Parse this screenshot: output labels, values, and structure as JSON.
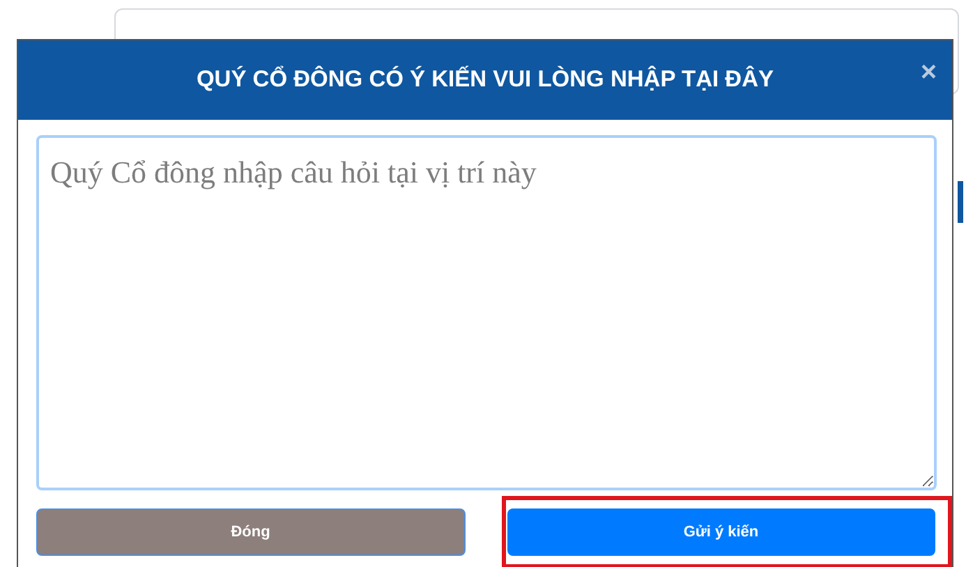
{
  "dialog": {
    "title": "QUÝ CỔ ĐÔNG CÓ Ý KIẾN VUI LÒNG NHẬP TẠI ĐÂY",
    "close": "×",
    "question": {
      "placeholder": "Quý Cổ đông nhập câu hỏi tại vị trí này"
    },
    "buttons": [
      {
        "kind": "secondary",
        "label": "Đóng",
        "highlighted": false
      },
      {
        "kind": "primary",
        "label": "Gửi ý kiến",
        "highlighted": true
      }
    ]
  }
}
